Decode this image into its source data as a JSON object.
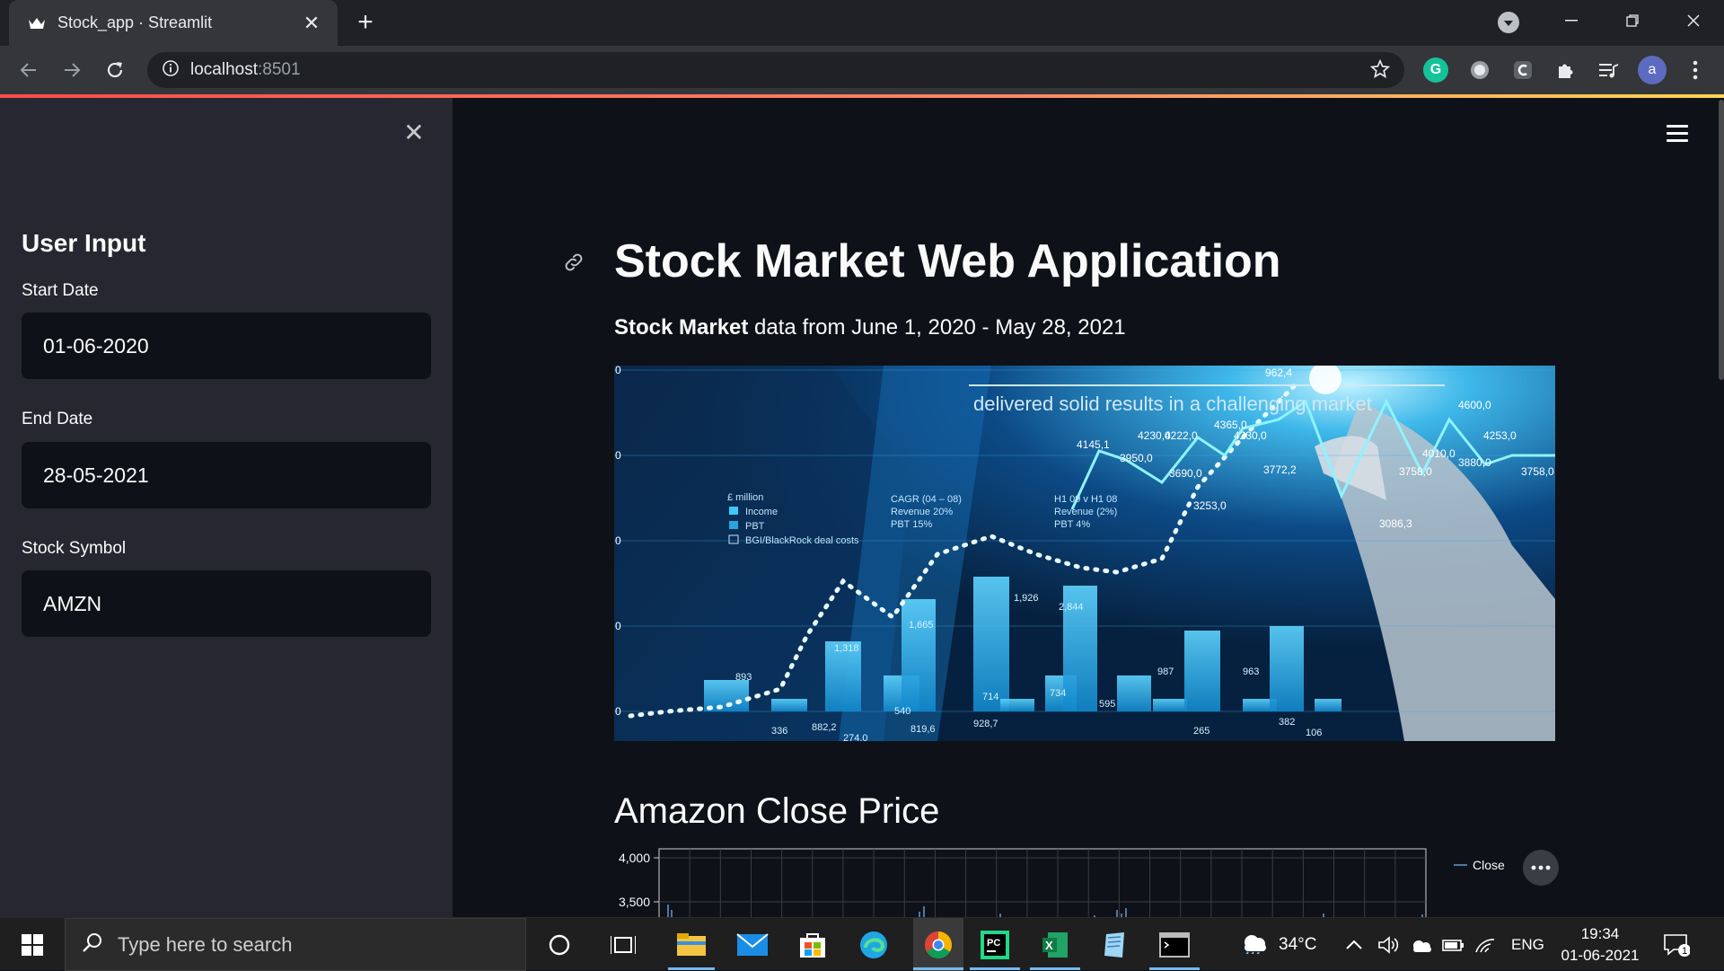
{
  "browser": {
    "tab_title": "Stock_app · Streamlit",
    "url_host": "localhost",
    "url_port": ":8501",
    "profile_initial": "a"
  },
  "sidebar": {
    "header": "User Input",
    "fields": [
      {
        "label": "Start Date",
        "value": "01-06-2020"
      },
      {
        "label": "End Date",
        "value": "28-05-2021"
      },
      {
        "label": "Stock Symbol",
        "value": "AMZN"
      }
    ]
  },
  "main": {
    "title": "Stock Market Web Application",
    "subtitle_bold": "Stock Market",
    "subtitle_rest": " data from June 1, 2020 - May 28, 2021",
    "section_title": "Amazon Close Price"
  },
  "hero_image": {
    "headline": "delivered solid results in a challenging market",
    "labels": [
      "4145,1",
      "4230,0",
      "4222,0",
      "4365,0",
      "4230,0",
      "3950,0",
      "3690,0",
      "3772,2",
      "4600,0",
      "4253,0",
      "4010,0",
      "3880,0",
      "3758,0",
      "3758,0",
      "3253,0",
      "3086,3",
      "962,4"
    ],
    "legend": [
      "£ million",
      "Income",
      "PBT",
      "BGI/BlackRock deal costs"
    ],
    "notes": [
      "CAGR (04 – 08)",
      "Revenue   20%",
      "PBT   15%",
      "H1 09 v H1 08",
      "Revenue   (2%)",
      "PBT   4%"
    ],
    "bar_values": [
      "893",
      "336",
      "882,2",
      "1,318",
      "274,0",
      "540",
      "1,665",
      "819,6",
      "714",
      "928,7",
      "1,926",
      "734",
      "2,844",
      "595",
      "987",
      "265",
      "963",
      "382",
      "106"
    ],
    "axis_ticks": [
      "0",
      "0",
      "0",
      "0",
      "0"
    ]
  },
  "chart_data": {
    "type": "line",
    "title": "",
    "series": [
      {
        "name": "Close",
        "values": []
      }
    ],
    "y_ticks": [
      "4,000",
      "3,500"
    ],
    "ylim": [
      3300,
      4000
    ],
    "legend_position": "top-right"
  },
  "taskbar": {
    "search_placeholder": "Type here to search",
    "weather": "34°C",
    "language": "ENG",
    "time": "19:34",
    "date": "01-06-2021",
    "notification_count": "1"
  },
  "colors": {
    "accent": "#ff4b4b",
    "sidebar_bg": "#262730",
    "main_bg": "#0e1117",
    "chart_line": "#4c78a8"
  }
}
